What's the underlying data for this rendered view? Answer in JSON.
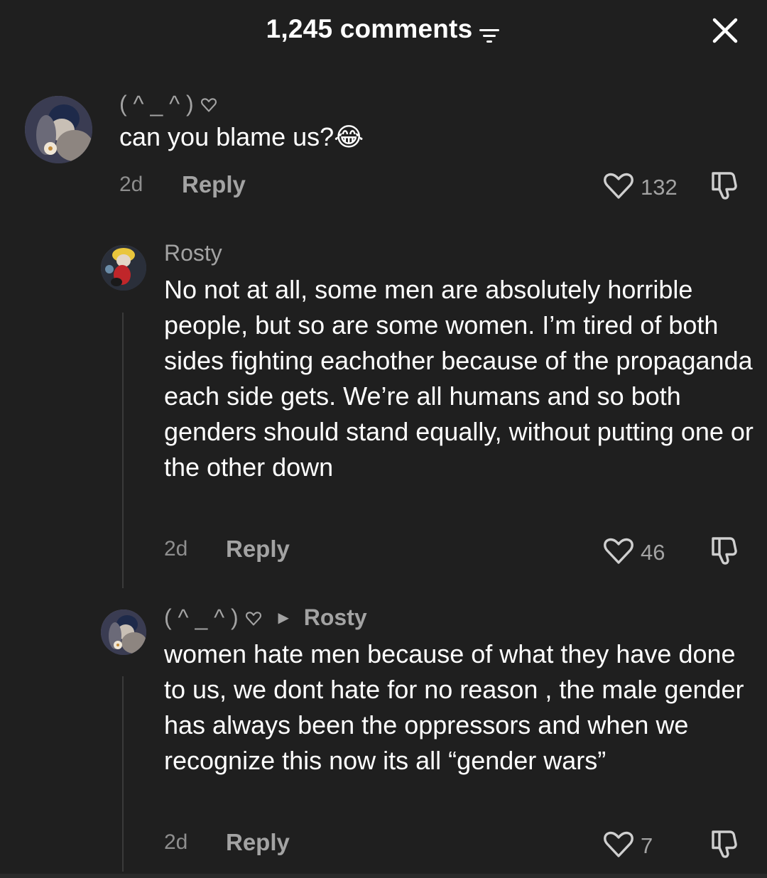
{
  "header": {
    "title": "1,245 comments"
  },
  "comments": [
    {
      "username": "( ^ _ ^ )",
      "text": "can you blame us?😂",
      "time": "2d",
      "reply_label": "Reply",
      "likes": "132"
    },
    {
      "username": "Rosty",
      "text": "No not at all, some men are absolutely horrible people, but so are some women. I’m tired of both sides fighting eachother because of the propaganda each side gets. We’re all humans and so both genders should stand equally, without putting one or the other down",
      "time": "2d",
      "reply_label": "Reply",
      "likes": "46"
    },
    {
      "username": "( ^ _ ^ )",
      "reply_to": "Rosty",
      "text": "women hate men because of what they have done to us, we dont hate for no reason , the male gender has always been the oppressors and when we recognize this now its all “gender wars”",
      "time": "2d",
      "reply_label": "Reply",
      "likes": "7"
    }
  ],
  "colors": {
    "background": "#1f1f1f",
    "text_primary": "#ffffff",
    "text_secondary": "#a3a3a3"
  }
}
